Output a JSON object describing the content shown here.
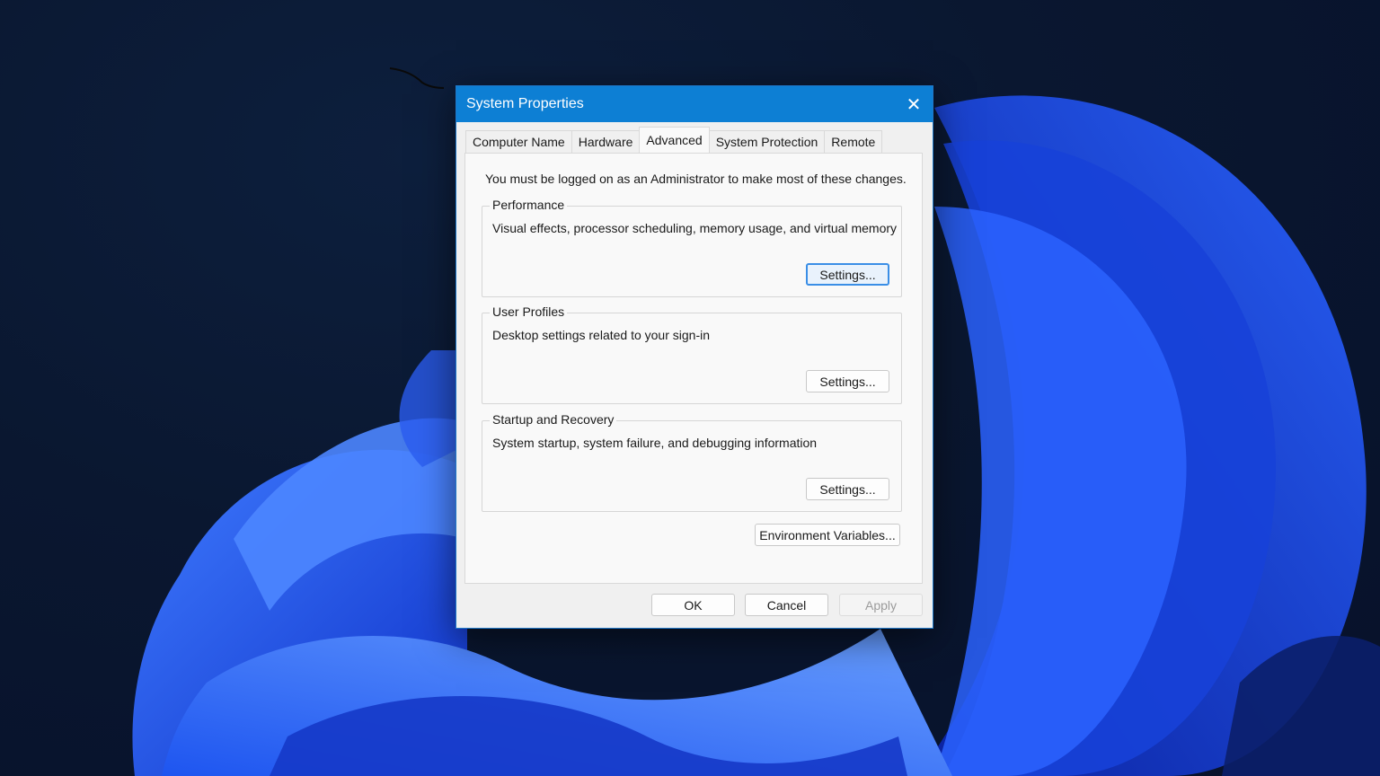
{
  "dialog": {
    "title": "System Properties",
    "close_glyph": "✕"
  },
  "tabs": [
    {
      "label": "Computer Name",
      "active": false
    },
    {
      "label": "Hardware",
      "active": false
    },
    {
      "label": "Advanced",
      "active": true
    },
    {
      "label": "System Protection",
      "active": false
    },
    {
      "label": "Remote",
      "active": false
    }
  ],
  "advanced": {
    "admin_note": "You must be logged on as an Administrator to make most of these changes.",
    "performance": {
      "title": "Performance",
      "description": "Visual effects, processor scheduling, memory usage, and virtual memory",
      "button": "Settings..."
    },
    "user_profiles": {
      "title": "User Profiles",
      "description": "Desktop settings related to your sign-in",
      "button": "Settings..."
    },
    "startup_recovery": {
      "title": "Startup and Recovery",
      "description": "System startup, system failure, and debugging information",
      "button": "Settings..."
    },
    "env_button": "Environment Variables..."
  },
  "footer": {
    "ok": "OK",
    "cancel": "Cancel",
    "apply": "Apply"
  },
  "colors": {
    "titlebar": "#0d7fd4",
    "focus_ring": "#3a8ee6",
    "wallpaper_bloom": "#1f5cff"
  },
  "icons": [
    "close-icon"
  ]
}
